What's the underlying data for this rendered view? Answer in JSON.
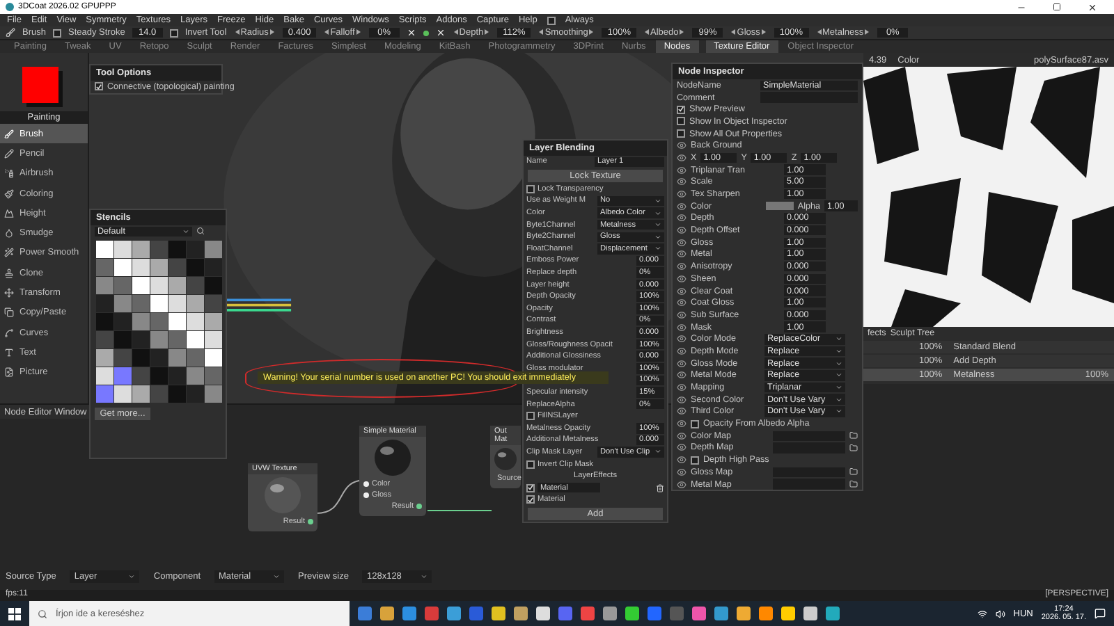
{
  "window": {
    "title": "3DCoat 2026.02 GPUPPP"
  },
  "menu": [
    "File",
    "Edit",
    "View",
    "Symmetry",
    "Textures",
    "Layers",
    "Freeze",
    "Hide",
    "Bake",
    "Curves",
    "Windows",
    "Scripts",
    "Addons",
    "Capture",
    "Help"
  ],
  "always": {
    "label": "Always",
    "checked": false
  },
  "toolbar": [
    {
      "kind": "tool",
      "label": "Brush"
    },
    {
      "kind": "check",
      "label": "Steady Stroke",
      "checked": false
    },
    {
      "kind": "value",
      "value": "14.0"
    },
    {
      "kind": "check",
      "label": "Invert Tool",
      "checked": false
    },
    {
      "kind": "param",
      "label": "Radius",
      "value": "0.400"
    },
    {
      "kind": "param",
      "label": "Falloff",
      "value": "0%"
    },
    {
      "kind": "symmetry"
    },
    {
      "kind": "param",
      "label": "Depth",
      "value": "112%"
    },
    {
      "kind": "param",
      "label": "Smoothing",
      "value": "100%"
    },
    {
      "kind": "param",
      "label": "Albedo",
      "value": "99%"
    },
    {
      "kind": "param",
      "label": "Gloss",
      "value": "100%"
    },
    {
      "kind": "param",
      "label": "Metalness",
      "value": "0%"
    }
  ],
  "rooms": [
    {
      "label": "Painting",
      "selected": false
    },
    {
      "label": "Tweak",
      "selected": false
    },
    {
      "label": "UV",
      "selected": false
    },
    {
      "label": "Retopo",
      "selected": false
    },
    {
      "label": "Sculpt",
      "selected": false
    },
    {
      "label": "Render",
      "selected": false
    },
    {
      "label": "Factures",
      "selected": false
    },
    {
      "label": "Simplest",
      "selected": false
    },
    {
      "label": "Modeling",
      "selected": false
    },
    {
      "label": "KitBash",
      "selected": false
    },
    {
      "label": "Photogrammetry",
      "selected": false
    },
    {
      "label": "3DPrint",
      "selected": false
    },
    {
      "label": "Nurbs",
      "selected": false
    },
    {
      "label": "Nodes",
      "selected": true
    }
  ],
  "right_tabs": [
    {
      "label": "Texture Editor",
      "selected": true
    },
    {
      "label": "Object Inspector",
      "selected": false
    }
  ],
  "tool_panel": {
    "color": "#ff0000",
    "section": "Painting",
    "tools": [
      {
        "label": "Brush",
        "selected": true
      },
      {
        "label": "Pencil",
        "selected": false
      },
      {
        "label": "Airbrush",
        "selected": false
      },
      {
        "label": "Coloring",
        "selected": false
      },
      {
        "label": "Height",
        "selected": false
      },
      {
        "label": "Smudge",
        "selected": false
      },
      {
        "label": "Power Smooth",
        "selected": false
      },
      {
        "label": "Clone",
        "selected": false
      },
      {
        "label": "Transform",
        "selected": false
      },
      {
        "label": "Copy/Paste",
        "selected": false
      },
      {
        "label": "Curves",
        "selected": false
      },
      {
        "label": "Text",
        "selected": false
      },
      {
        "label": "Picture",
        "selected": false
      }
    ]
  },
  "tool_options": {
    "title": "Tool Options",
    "option": {
      "label": "Connective (topological) painting",
      "checked": true
    }
  },
  "stencils": {
    "title": "Stencils",
    "preset": "Default",
    "button": "Get more..."
  },
  "warning": "Warning! Your serial number is used on another PC! You should exit immediately",
  "layer_blending": {
    "title": "Layer Blending",
    "rows": [
      {
        "kind": "name",
        "label": "Name",
        "value": "Layer 1"
      },
      {
        "kind": "button",
        "label": "Lock Texture"
      },
      {
        "kind": "check",
        "label": "Lock Transparency",
        "checked": false
      },
      {
        "kind": "select",
        "label": "Use as Weight M",
        "value": "No"
      },
      {
        "kind": "select",
        "label": "Color",
        "value": "Albedo Color"
      },
      {
        "kind": "select",
        "label": "Byte1Channel",
        "value": "Metalness"
      },
      {
        "kind": "select",
        "label": "Byte2Channel",
        "value": "Gloss"
      },
      {
        "kind": "select",
        "label": "FloatChannel",
        "value": "Displacement"
      },
      {
        "kind": "param",
        "label": "Emboss Power",
        "value": "0.000"
      },
      {
        "kind": "param",
        "label": "Replace depth",
        "value": "0%"
      },
      {
        "kind": "param",
        "label": "Layer height",
        "value": "0.000"
      },
      {
        "kind": "param",
        "label": "Depth Opacity",
        "value": "100%"
      },
      {
        "kind": "param",
        "label": "Opacity",
        "value": "100%"
      },
      {
        "kind": "param",
        "label": "Contrast",
        "value": "0%"
      },
      {
        "kind": "param",
        "label": "Brightness",
        "value": "0.000"
      },
      {
        "kind": "param",
        "label": "Gloss/Roughness Opacit",
        "value": "100%"
      },
      {
        "kind": "param",
        "label": "Additional Glossiness",
        "value": "0.000"
      },
      {
        "kind": "param",
        "label": "Gloss modulator",
        "value": "100%"
      },
      {
        "kind": "param",
        "label": "",
        "value": "100%"
      },
      {
        "kind": "param",
        "label": "Specular intensity",
        "value": "15%"
      },
      {
        "kind": "param",
        "label": "ReplaceAlpha",
        "value": "0%"
      },
      {
        "kind": "check",
        "label": "FillNSLayer",
        "checked": false
      },
      {
        "kind": "param",
        "label": "Metalness Opacity",
        "value": "100%"
      },
      {
        "kind": "param",
        "label": "Additional Metalness",
        "value": "0.000"
      },
      {
        "kind": "select",
        "label": "Clip Mask Layer",
        "value": "Don't Use Clip"
      },
      {
        "kind": "check",
        "label": "Invert Clip Mask",
        "checked": false
      },
      {
        "kind": "heading",
        "label": "LayerEffects"
      },
      {
        "kind": "effect",
        "label": "Material",
        "checked": true
      },
      {
        "kind": "check",
        "label": "Material",
        "checked": true
      },
      {
        "kind": "button",
        "label": "Add"
      }
    ]
  },
  "node_inspector": {
    "title": "Node Inspector",
    "node_name": {
      "label": "NodeName",
      "value": "SimpleMaterial"
    },
    "comment": {
      "label": "Comment"
    },
    "options": [
      {
        "label": "Show Preview",
        "checked": true
      },
      {
        "label": "Show In Object Inspector",
        "checked": false
      },
      {
        "label": "Show All Out Properties",
        "checked": false
      }
    ],
    "rows": [
      {
        "kind": "header",
        "label": "Back Ground"
      },
      {
        "kind": "xyz",
        "items": [
          {
            "label": "X",
            "value": "1.00"
          },
          {
            "label": "Y",
            "value": "1.00"
          },
          {
            "label": "Z",
            "value": "1.00"
          }
        ]
      },
      {
        "kind": "param",
        "label": "Triplanar Tran",
        "value": "1.00"
      },
      {
        "kind": "param",
        "label": "Scale",
        "value": "5.00"
      },
      {
        "kind": "param",
        "label": "Tex Sharpen",
        "value": "1.00"
      },
      {
        "kind": "color",
        "label": "Color",
        "alpha_label": "Alpha",
        "value": "1.00"
      },
      {
        "kind": "param",
        "label": "Depth",
        "value": "0.000"
      },
      {
        "kind": "param",
        "label": "Depth Offset",
        "value": "0.000"
      },
      {
        "kind": "param",
        "label": "Gloss",
        "value": "1.00"
      },
      {
        "kind": "param",
        "label": "Metal",
        "value": "1.00"
      },
      {
        "kind": "param",
        "label": "Anisotropy",
        "value": "0.000"
      },
      {
        "kind": "param",
        "label": "Sheen",
        "value": "0.000"
      },
      {
        "kind": "param",
        "label": "Clear Coat",
        "value": "0.000"
      },
      {
        "kind": "param",
        "label": "Coat Gloss",
        "value": "1.00"
      },
      {
        "kind": "param",
        "label": "Sub Surface",
        "value": "0.000"
      },
      {
        "kind": "param",
        "label": "Mask",
        "value": "1.00"
      },
      {
        "kind": "select",
        "label": "Color Mode",
        "value": "ReplaceColor"
      },
      {
        "kind": "select",
        "label": "Depth Mode",
        "value": "Replace"
      },
      {
        "kind": "select",
        "label": "Gloss Mode",
        "value": "Replace"
      },
      {
        "kind": "select",
        "label": "Metal Mode",
        "value": "Replace"
      },
      {
        "kind": "select",
        "label": "Mapping",
        "value": "Triplanar"
      },
      {
        "kind": "select",
        "label": "Second Color",
        "value": "Don't Use Vary"
      },
      {
        "kind": "select",
        "label": "Third Color",
        "value": "Don't Use Vary"
      },
      {
        "kind": "check",
        "label": "Opacity From Albedo Alpha",
        "checked": false
      },
      {
        "kind": "map",
        "label": "Color Map"
      },
      {
        "kind": "map",
        "label": "Depth Map"
      },
      {
        "kind": "check",
        "label": "Depth High Pass",
        "checked": false
      },
      {
        "kind": "map",
        "label": "Gloss Map"
      },
      {
        "kind": "map",
        "label": "Metal Map"
      }
    ]
  },
  "texture_editor": {
    "zoom": "4.39",
    "channel": "Color",
    "file": "polySurface87.asv"
  },
  "layers": {
    "tabs": [
      "fects",
      "Sculpt Tree"
    ],
    "rows": [
      {
        "opacity": "100%",
        "name": "Standard Blend",
        "selected": false
      },
      {
        "opacity": "100%",
        "name": "Add Depth",
        "selected": false
      },
      {
        "opacity": "100%",
        "name": "Metalness",
        "value": "100%",
        "selected": true
      }
    ]
  },
  "node_editor": {
    "title": "Node Editor Window",
    "nodes": [
      {
        "kind": "texture",
        "title": "UVW Texture",
        "outputs": [
          "Result"
        ]
      },
      {
        "kind": "material",
        "title": "Simple Material",
        "inputs": [
          "Color",
          "Gloss"
        ],
        "outputs": [
          "Result"
        ]
      },
      {
        "kind": "output",
        "title": "Out Mat",
        "inputs": [
          "Source"
        ]
      }
    ]
  },
  "bottom_bar": [
    {
      "label": "Source Type",
      "value": "Layer"
    },
    {
      "label": "Component",
      "value": "Material"
    },
    {
      "label": "Preview size",
      "value": "128x128"
    }
  ],
  "status": {
    "fps": "fps:11",
    "view": "[PERSPECTIVE]"
  },
  "taskbar": {
    "search": "Írjon ide a kereséshez",
    "language": "HUN",
    "time": "17:24",
    "date": "2026. 05. 17."
  }
}
